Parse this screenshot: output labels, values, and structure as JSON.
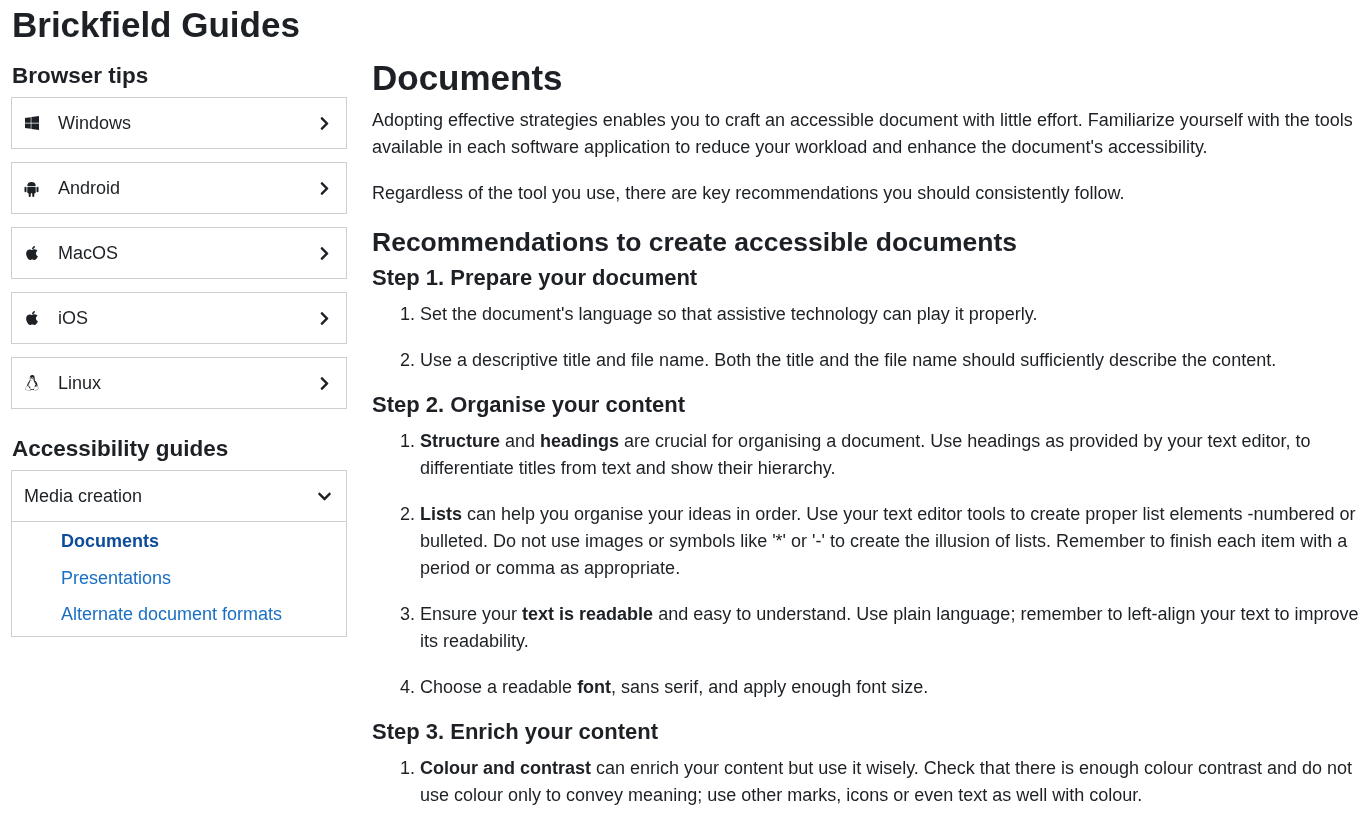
{
  "site_title": "Brickfield Guides",
  "sidebar": {
    "sections": [
      {
        "heading": "Browser tips",
        "items": [
          {
            "label": "Windows",
            "kind": "windows",
            "expanded": false
          },
          {
            "label": "Android",
            "kind": "android",
            "expanded": false
          },
          {
            "label": "MacOS",
            "kind": "apple",
            "expanded": false
          },
          {
            "label": "iOS",
            "kind": "apple",
            "expanded": false
          },
          {
            "label": "Linux",
            "kind": "linux",
            "expanded": false
          }
        ]
      },
      {
        "heading": "Accessibility guides",
        "items": [
          {
            "label": "Media creation",
            "kind": "plain",
            "expanded": true,
            "children": [
              {
                "label": "Documents",
                "selected": true
              },
              {
                "label": "Presentations",
                "selected": false
              },
              {
                "label": "Alternate document formats",
                "selected": false
              }
            ]
          }
        ]
      }
    ]
  },
  "main": {
    "title": "Documents",
    "intro": [
      "Adopting effective strategies enables you to craft an accessible document with little effort. Familiarize yourself with the tools available in each software application to reduce your workload and enhance the document's accessibility.",
      "Regardless of the tool you use, there are key recommendations you should consistently follow."
    ],
    "section_heading": "Recommendations to create accessible documents",
    "steps": [
      {
        "heading": "Step 1. Prepare your document",
        "items": [
          {
            "number": "1.",
            "text": "Set the document's language so that assistive technology can play it properly."
          },
          {
            "number": "2.",
            "text": "Use a descriptive title and file name. Both the title and the file name should sufficiently describe the content."
          }
        ]
      },
      {
        "heading": "Step 2. Organise your content",
        "items": [
          {
            "number": "1.",
            "text": "**Structure** and **headings** are crucial for organising a document. Use headings as provided by your text editor, to differentiate titles from text and show their hierarchy."
          },
          {
            "number": "2.",
            "text": "**Lists** can help you organise your ideas in order. Use your text editor tools to create proper list elements -numbered or bulleted. Do not use images or symbols like '*' or '-' to create the illusion of lists. Remember to finish each item with a period or comma as appropriate."
          },
          {
            "number": "3.",
            "text": "Ensure your **text is readable** and easy to understand. Use plain language; remember to left-align your text to improve its readability."
          },
          {
            "number": "4.",
            "text": "Choose a readable **font**, sans serif, and apply enough font size."
          }
        ]
      },
      {
        "heading": "Step 3. Enrich your content",
        "items": [
          {
            "number": "1.",
            "text": "**Colour and contrast** can enrich your content but use it wisely. Check that there is enough colour contrast and do not use colour only to convey meaning; use other marks, icons or even text as well with colour."
          }
        ]
      }
    ]
  }
}
